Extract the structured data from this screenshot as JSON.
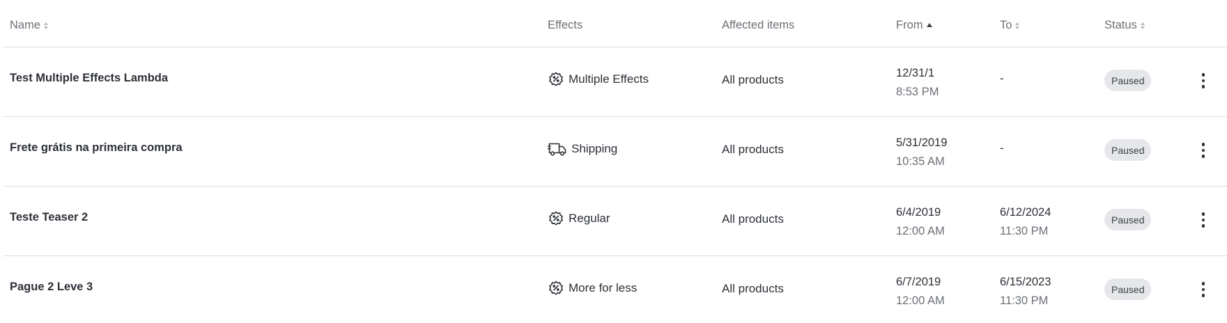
{
  "columns": {
    "name": "Name",
    "effects": "Effects",
    "affected": "Affected items",
    "from": "From",
    "to": "To",
    "status": "Status"
  },
  "rows": [
    {
      "name": "Test Multiple Effects Lambda",
      "effect_icon": "percent-badge-icon",
      "effect": "Multiple Effects",
      "affected": "All products",
      "from_date": "12/31/1",
      "from_time": "8:53 PM",
      "to_date": "-",
      "to_time": "",
      "status": "Paused"
    },
    {
      "name": "Frete grátis na primeira compra",
      "effect_icon": "truck-icon",
      "effect": "Shipping",
      "affected": "All products",
      "from_date": "5/31/2019",
      "from_time": "10:35 AM",
      "to_date": "-",
      "to_time": "",
      "status": "Paused"
    },
    {
      "name": "Teste Teaser 2",
      "effect_icon": "percent-badge-icon",
      "effect": "Regular",
      "affected": "All products",
      "from_date": "6/4/2019",
      "from_time": "12:00 AM",
      "to_date": "6/12/2024",
      "to_time": "11:30 PM",
      "status": "Paused"
    },
    {
      "name": "Pague 2 Leve 3",
      "effect_icon": "percent-badge-icon",
      "effect": "More for less",
      "affected": "All products",
      "from_date": "6/7/2019",
      "from_time": "12:00 AM",
      "to_date": "6/15/2023",
      "to_time": "11:30 PM",
      "status": "Paused"
    }
  ],
  "colors": {
    "text": "#2b2f36",
    "muted": "#6b6f76",
    "border": "#dcdde0",
    "badge_bg": "#e6e7ea"
  }
}
